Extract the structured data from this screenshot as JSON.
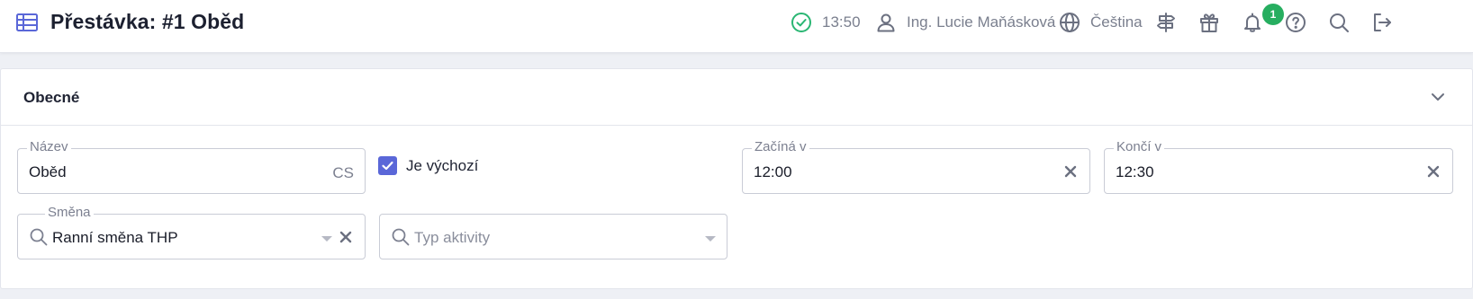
{
  "header": {
    "title": "Přestávka: #1 Oběd",
    "title_icon": "table-icon",
    "status_icon": "check-circle-icon",
    "time": "13:50",
    "user_icon": "user-icon",
    "user_name": "Ing. Lucie Maňásková",
    "language_icon": "globe-icon",
    "language": "Čeština",
    "icons": [
      "signpost-icon",
      "gift-icon",
      "bell-icon",
      "help-icon",
      "search-icon",
      "logout-icon"
    ],
    "gift_badge": "1"
  },
  "section": {
    "title": "Obecné",
    "toggle_icon": "chevron-down-icon"
  },
  "form": {
    "name": {
      "label": "Název",
      "value": "Oběd",
      "suffix": "CS"
    },
    "is_default": {
      "label": "Je výchozí",
      "checked": true
    },
    "starts": {
      "label": "Začíná v",
      "value": "12:00"
    },
    "ends": {
      "label": "Končí v",
      "value": "12:30"
    },
    "shift": {
      "label": "Směna",
      "value": "Ranní směna THP"
    },
    "activity_type": {
      "placeholder": "Typ aktivity"
    }
  },
  "colors": {
    "accent": "#5a67d8",
    "success": "#27ae60",
    "status_ok": "#2ab673"
  }
}
